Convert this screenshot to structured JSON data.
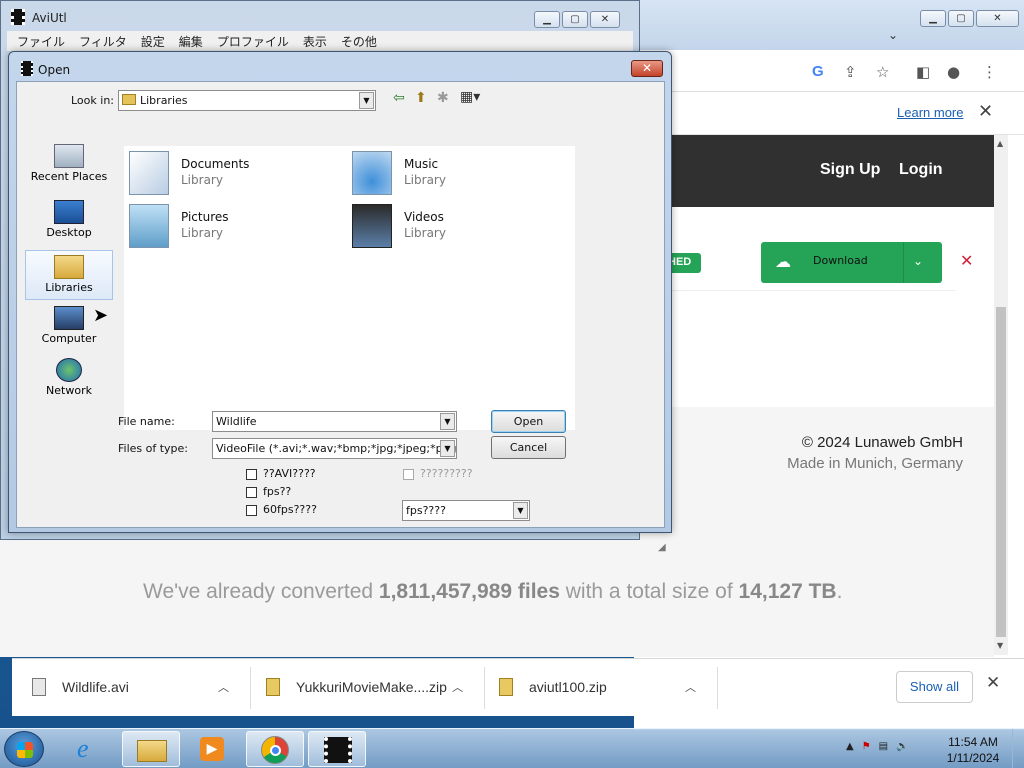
{
  "aviutl": {
    "title": "AviUtl",
    "menu": [
      "ファイル",
      "フィルタ",
      "設定",
      "編集",
      "プロファイル",
      "表示",
      "その他"
    ]
  },
  "open_dialog": {
    "title": "Open",
    "look_in_label": "Look in:",
    "look_in_value": "Libraries",
    "places": [
      "Recent Places",
      "Desktop",
      "Libraries",
      "Computer",
      "Network"
    ],
    "items": [
      {
        "name": "Documents",
        "type": "Library"
      },
      {
        "name": "Music",
        "type": "Library"
      },
      {
        "name": "Pictures",
        "type": "Library"
      },
      {
        "name": "Videos",
        "type": "Library"
      }
    ],
    "file_name_label": "File name:",
    "file_name_value": "Wildlife",
    "file_type_label": "Files of type:",
    "file_type_value": "VideoFile (*.avi;*.wav;*bmp;*jpg;*jpeg;*png)",
    "open_btn": "Open",
    "cancel_btn": "Cancel",
    "checkbox1": "??AVI????",
    "checkbox2": "fps??",
    "checkbox3": "60fps????",
    "checkbox_disabled": "?????????",
    "fps_select": "fps????"
  },
  "chrome": {
    "learn_more": "Learn more",
    "nav": {
      "signup": "Sign Up",
      "login": "Login"
    },
    "badge": "HED",
    "download_btn": "Download",
    "copyright": "© 2024 Lunaweb GmbH",
    "made_in": "Made in Munich, Germany",
    "converted": {
      "prefix": "We've already converted ",
      "files": "1,811,457,989 files",
      "middle": " with a total size of ",
      "size": "14,127 TB",
      "suffix": "."
    }
  },
  "downloads": [
    {
      "name": "Wildlife.avi",
      "icon": "video-file-icon"
    },
    {
      "name": "YukkuriMovieMake....zip",
      "icon": "zip-file-icon"
    },
    {
      "name": "aviutl100.zip",
      "icon": "zip-file-icon"
    }
  ],
  "show_all": "Show all",
  "taskbar": {
    "apps": [
      "internet-explorer",
      "windows-explorer",
      "media-player",
      "google-chrome",
      "aviutl"
    ],
    "time": "11:54 AM",
    "date": "1/11/2024"
  },
  "colors": {
    "brand_green": "#25a356",
    "chrome_nav": "#303030",
    "link_blue": "#1a5fb4"
  }
}
